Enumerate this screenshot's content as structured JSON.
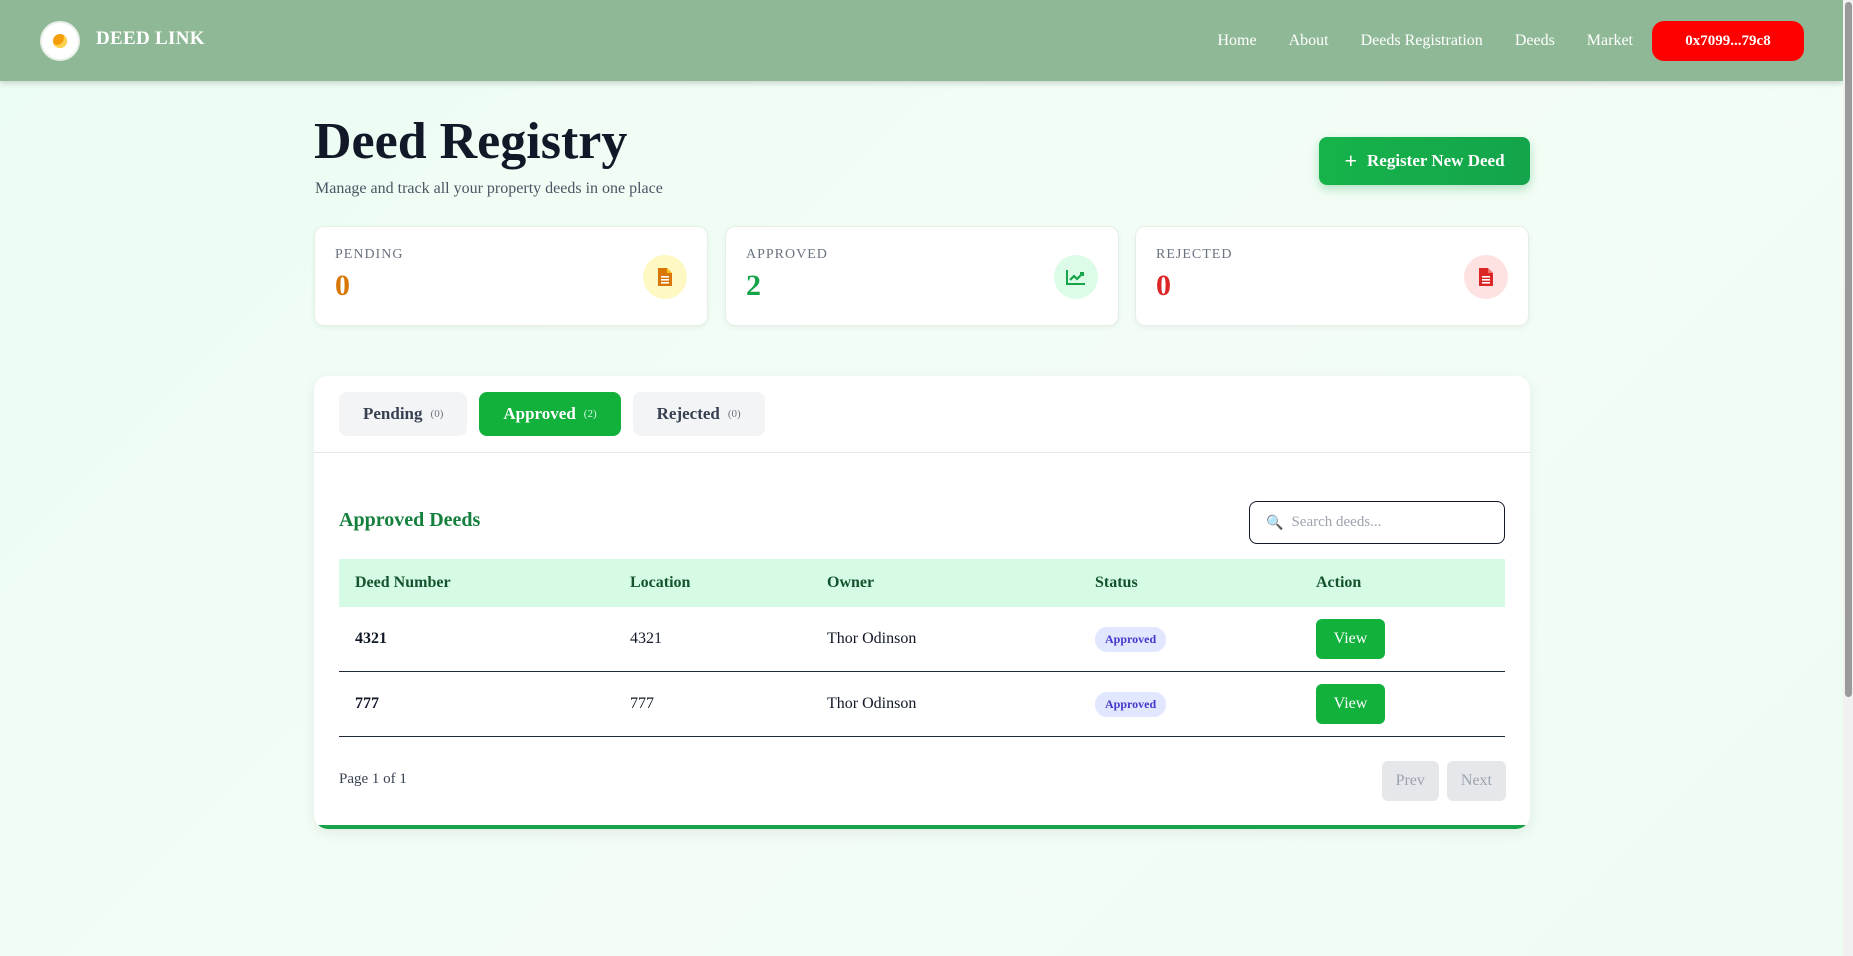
{
  "navbar": {
    "brand": "DEED LINK",
    "links": [
      "Home",
      "About",
      "Deeds Registration",
      "Deeds",
      "Market"
    ],
    "wallet": "0x7099...79c8",
    "wallet_color": "#ff0000",
    "bar_color": "#8fb996"
  },
  "header": {
    "title": "Deed Registry",
    "subtitle": "Manage and track all your property deeds in one place",
    "register_button": "Register New Deed"
  },
  "stats": [
    {
      "label": "PENDING",
      "value": "0",
      "color": "#d97706",
      "icon": "document-icon",
      "icon_bg": "#fef9c3"
    },
    {
      "label": "APPROVED",
      "value": "2",
      "color": "#16a34a",
      "icon": "chart-line-icon",
      "icon_bg": "#dcfce7"
    },
    {
      "label": "REJECTED",
      "value": "0",
      "color": "#dc2626",
      "icon": "document-icon",
      "icon_bg": "#fee2e2"
    }
  ],
  "tabs": [
    {
      "label": "Pending",
      "count": "(0)",
      "active": false
    },
    {
      "label": "Approved",
      "count": "(2)",
      "active": true
    },
    {
      "label": "Rejected",
      "count": "(0)",
      "active": false
    }
  ],
  "section": {
    "title": "Approved Deeds",
    "search_placeholder": "Search deeds..."
  },
  "table": {
    "headers": [
      "Deed Number",
      "Location",
      "Owner",
      "Status",
      "Action"
    ],
    "rows": [
      {
        "deed_number": "4321",
        "location": "4321",
        "owner": "Thor Odinson",
        "status": "Approved",
        "action": "View"
      },
      {
        "deed_number": "777",
        "location": "777",
        "owner": "Thor Odinson",
        "status": "Approved",
        "action": "View"
      }
    ]
  },
  "pagination": {
    "info": "Page 1 of 1",
    "prev": "Prev",
    "next": "Next"
  },
  "accent_color": "#11b13c"
}
